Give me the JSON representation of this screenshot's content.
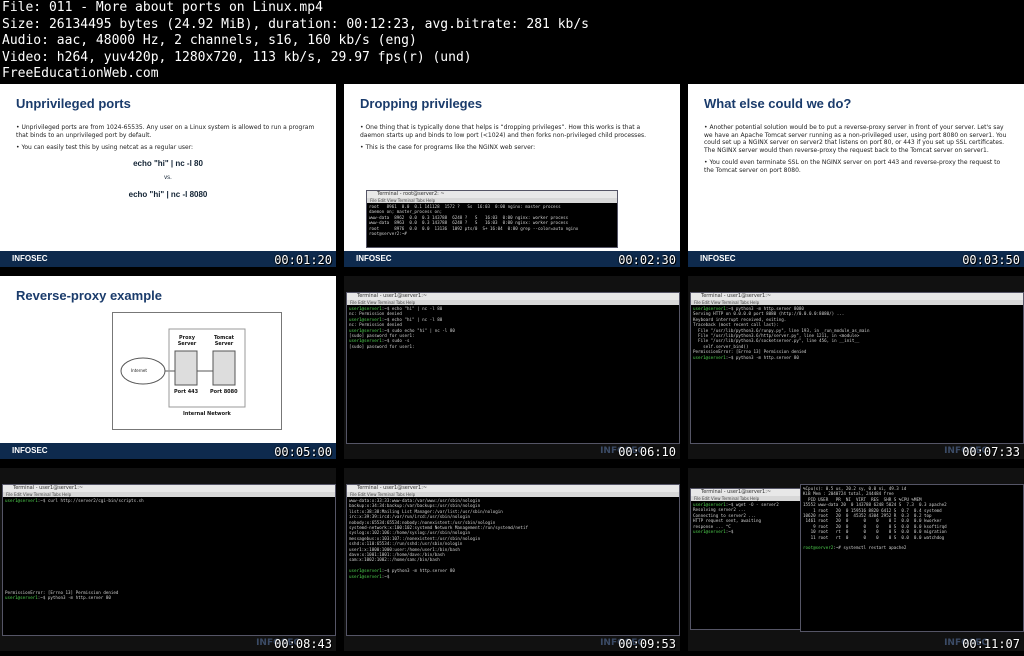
{
  "header": {
    "file": "File: 011 - More about ports on Linux.mp4",
    "size": "Size: 26134495 bytes (24.92 MiB), duration: 00:12:23, avg.bitrate: 281 kb/s",
    "audio": "Audio: aac, 48000 Hz, 2 channels, s16, 160 kb/s (eng)",
    "video": "Video: h264, yuv420p, 1280x720, 113 kb/s, 29.97 fps(r) (und)",
    "site": "FreeEducationWeb.com"
  },
  "brand": "INFOSEC",
  "thumbs": [
    {
      "time": "00:01:20",
      "title": "Unprivileged ports",
      "p1": "Unprivileged ports are from 1024-65535. Any user on a Linux system is allowed to run a program that binds to an unprivileged port by default.",
      "p2": "You can easily test this by using netcat as a regular user:",
      "cmd1": "echo \"hi\" | nc -l 80",
      "vs": "vs.",
      "cmd2": "echo \"hi\" | nc -l 8080"
    },
    {
      "time": "00:02:30",
      "title": "Dropping privileges",
      "p1": "One thing that is typically done that helps is “dropping privileges”. How this works is that a daemon starts up and binds to low port (<1024) and then forks non-privileged child processes.",
      "p2": "This is the case for programs like the NGINX web server:"
    },
    {
      "time": "00:03:50",
      "title": "What else could we do?",
      "p1": "Another potential solution would be to put a reverse-proxy server in front of your server. Let's say we have an Apache Tomcat server running as a non-privileged user, using port 8080 on server1. You could set up a NGINX server on server2 that listens on port 80, or 443 if you set up SSL certificates. The NGINX server would then reverse-proxy the request back to the Tomcat server on server1.",
      "p2": "You could even terminate SSL on the NGINX server on port 443 and reverse-proxy the request to the Tomcat server on port 8080."
    },
    {
      "time": "00:05:00",
      "title": "Reverse-proxy example",
      "internet": "Internet",
      "proxy": "Proxy Server",
      "tomcat": "Tomcat Server",
      "port443": "Port 443",
      "port8080": "Port 8080",
      "network": "Internal Network"
    },
    {
      "time": "00:06:10"
    },
    {
      "time": "00:07:33"
    },
    {
      "time": "00:08:43"
    },
    {
      "time": "00:09:53"
    },
    {
      "time": "00:11:07"
    }
  ],
  "terminal": {
    "title": "Terminal - user1@server1:~",
    "menu": "File  Edit  View  Terminal  Tabs  Help"
  }
}
